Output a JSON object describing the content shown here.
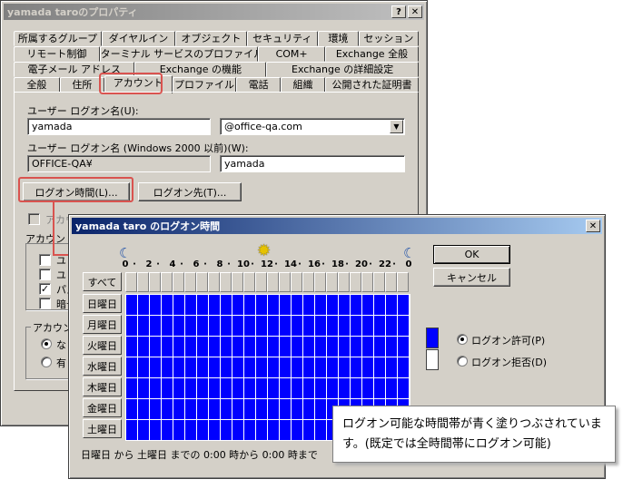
{
  "props": {
    "title": "yamada taroのプロパティ",
    "help": "?",
    "close": "✕",
    "tabs_row1": [
      "所属するグループ",
      "ダイヤルイン",
      "オブジェクト",
      "セキュリティ",
      "環境",
      "セッション"
    ],
    "tabs_row2": [
      "リモート制御",
      "ターミナル サービスのプロファイル",
      "COM+",
      "Exchange 全般"
    ],
    "tabs_row3": [
      "電子メール アドレス",
      "Exchange の機能",
      "Exchange の詳細設定"
    ],
    "tabs_row4": [
      "全般",
      "住所",
      "アカウント",
      "プロファイル",
      "電話",
      "組織",
      "公開された証明書"
    ],
    "logon_name_label": "ユーザー ログオン名(U):",
    "logon_name_value": "yamada",
    "domain_value": "@office-qa.com",
    "pre2000_label": "ユーザー ログオン名 (Windows 2000 以前)(W):",
    "pre2000_domain": "OFFICE-QA¥",
    "pre2000_name": "yamada",
    "logon_hours_button": "ログオン時間(L)...",
    "logon_to_button": "ログオン先(T)...",
    "unlock_label": "アカウントのロックアウト(C)",
    "account_options_label": "アカウント",
    "options": [
      "ユ",
      "ユ",
      "パス",
      "暗号"
    ],
    "expire_label": "アカウン",
    "expire_opts": [
      "なし",
      "有"
    ]
  },
  "hours": {
    "title": "yamada taro のログオン時間",
    "close": "✕",
    "ok": "OK",
    "cancel": "キャンセル",
    "all": "すべて",
    "hour_labels": [
      "0",
      "2",
      "4",
      "6",
      "8",
      "10",
      "12",
      "14",
      "16",
      "18",
      "20",
      "22",
      "0"
    ],
    "days": [
      "日曜日",
      "月曜日",
      "火曜日",
      "水曜日",
      "木曜日",
      "金曜日",
      "土曜日"
    ],
    "permit": "ログオン許可(P)",
    "deny": "ログオン拒否(D)",
    "status": "日曜日 から 土曜日 までの 0:00 時から 0:00 時まで",
    "permitted_color": "#0000ff",
    "denied_color": "#ffffff",
    "permitted_days": 7,
    "permitted_hours": 24
  },
  "callout": {
    "text": "ログオン可能な時間帯が青く塗りつぶされています。(既定では全時間帯にログオン可能)"
  },
  "highlight_color": "#d9534f"
}
